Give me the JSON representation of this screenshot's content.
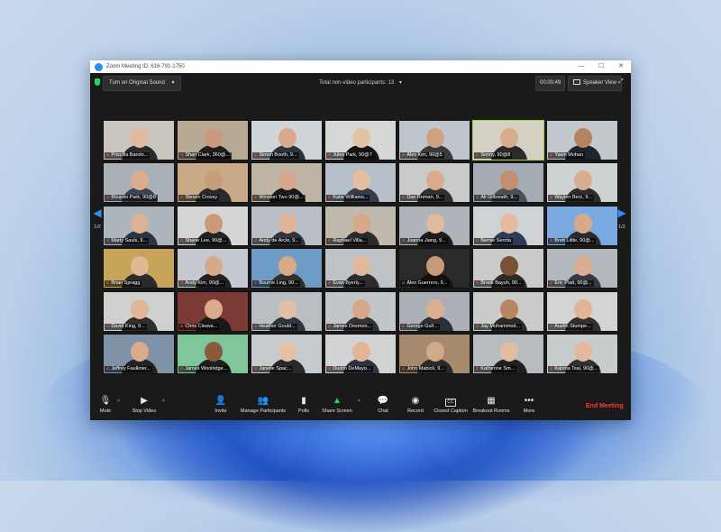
{
  "window": {
    "title": "Zoom Meeting ID: 616-791-1750",
    "controls": {
      "minimize": "—",
      "maximize": "☐",
      "close": "✕"
    }
  },
  "topbar": {
    "original_sound": "Turn on Original Sound",
    "original_sound_caret": "▾",
    "total_participants": "Total non-video participants: 13",
    "total_caret": "▾",
    "timer": "00:00:49",
    "view_button": "Speaker View",
    "fullscreen_glyph": "⤢"
  },
  "colors": {
    "accent": "#2d8cff",
    "end_meeting": "#ff3b30",
    "active_speaker": "#a3d24c",
    "muted": "#ff4d4d"
  },
  "pagination": {
    "left_page": "1/2",
    "right_page": "1/2",
    "left_arrow": "◀",
    "right_arrow": "▶"
  },
  "participants": [
    {
      "name": "Priscilla Barolo...",
      "bg": "#c9c6c0",
      "skin": "#e1b8a0",
      "shirt": "#2b2b2b"
    },
    {
      "name": "Shari Clark, 360@...",
      "bg": "#b7a993",
      "skin": "#c99a7d",
      "shirt": "#1f1f1f"
    },
    {
      "name": "Simon Booth, 9...",
      "bg": "#cfd4d8",
      "skin": "#d9a98c",
      "shirt": "#2c3440"
    },
    {
      "name": "Jules Park, 90@7",
      "bg": "#d6d8d6",
      "skin": "#e4c2a5",
      "shirt": "#151515"
    },
    {
      "name": "Alex Kim, 90@5",
      "bg": "#bfc5cc",
      "skin": "#cfa183",
      "shirt": "#3a3a3a"
    },
    {
      "name": "Sonny, 90@8",
      "bg": "#d4d0c4",
      "skin": "#d7ac8f",
      "shirt": "#2a2a2a",
      "active": true
    },
    {
      "name": "Yasin Mohan",
      "bg": "#c2c8cd",
      "skin": "#b7825f",
      "shirt": "#1d2430"
    },
    {
      "name": "Ricardo Park, 90@8",
      "bg": "#a9b0b6",
      "skin": "#dcae90",
      "shirt": "#3b4350"
    },
    {
      "name": "Steven Crossy",
      "bg": "#c9a986",
      "skin": "#c99c7c",
      "shirt": "#2a2a2a"
    },
    {
      "name": "Winston Twu 90@...",
      "bg": "#bfb5a4",
      "skin": "#d6a98a",
      "shirt": "#1a1a1a"
    },
    {
      "name": "Katie Williams...",
      "bg": "#b7c0c8",
      "skin": "#e6bfa3",
      "shirt": "#363d48"
    },
    {
      "name": "Dan Roman, 9...",
      "bg": "#c8cbc7",
      "skin": "#d9ab8c",
      "shirt": "#2f2f2f"
    },
    {
      "name": "Ali Gilbreath, 9...",
      "bg": "#a4abb2",
      "skin": "#c48f6f",
      "shirt": "#4a4f58"
    },
    {
      "name": "Waylen Berz, 9...",
      "bg": "#cfd2d3",
      "skin": "#d9ad90",
      "shirt": "#2c2c2c"
    },
    {
      "name": "Marty Sauls, 9...",
      "bg": "#adb5bd",
      "skin": "#ddb194",
      "shirt": "#2d3340"
    },
    {
      "name": "Shane Lee, 90@...",
      "bg": "#d3d5d6",
      "skin": "#c99b7b",
      "shirt": "#222"
    },
    {
      "name": "Andy de Arcle, 9...",
      "bg": "#b9bfc5",
      "skin": "#e0b597",
      "shirt": "#303640"
    },
    {
      "name": "Raphael Villa...",
      "bg": "#c0b9ae",
      "skin": "#d7a98a",
      "shirt": "#2b2b2b"
    },
    {
      "name": "Joanna Jiang, 9...",
      "bg": "#aeb4b9",
      "skin": "#e2b99c",
      "shirt": "#1d1d1d"
    },
    {
      "name": "Bernie Serota",
      "bg": "#cfd3d6",
      "skin": "#e4baa0",
      "shirt": "#2f3b52"
    },
    {
      "name": "Brett Little, 90@...",
      "bg": "#7aa9e0",
      "skin": "#d8aa8a",
      "shirt": "#2a2a2a"
    },
    {
      "name": "Brian Spragg",
      "bg": "#c6a55a",
      "skin": "#e0b896",
      "shirt": "#2b2b2b"
    },
    {
      "name": "Andy Kim, 90@...",
      "bg": "#c3c9ce",
      "skin": "#d7a98b",
      "shirt": "#222"
    },
    {
      "name": "Bourne Ling, 90...",
      "bg": "#6f9cc7",
      "skin": "#d8aa8a",
      "shirt": "#2f2f2f"
    },
    {
      "name": "Evan Byerly...",
      "bg": "#bfc3c6",
      "skin": "#e2b89a",
      "shirt": "#2c2c2c"
    },
    {
      "name": "Alex Guerrero, 9...",
      "bg": "#2a2a2a",
      "skin": "#c99a7a",
      "shirt": "#111"
    },
    {
      "name": "Brook Bayuh, 90...",
      "bg": "#c9cbc8",
      "skin": "#7a4f36",
      "shirt": "#2a2a2a"
    },
    {
      "name": "Eric Platt, 90@...",
      "bg": "#b2b8bd",
      "skin": "#dcae90",
      "shirt": "#333a45"
    },
    {
      "name": "David King, 9...",
      "bg": "#cfd1d1",
      "skin": "#e1b596",
      "shirt": "#2e2e2e"
    },
    {
      "name": "Chris Cleave...",
      "bg": "#7b3a33",
      "skin": "#d9ab8c",
      "shirt": "#1a1a1a"
    },
    {
      "name": "Heather Gould...",
      "bg": "#b9bec2",
      "skin": "#e4bea2",
      "shirt": "#2f3640"
    },
    {
      "name": "James Desmon...",
      "bg": "#c2c6c8",
      "skin": "#d6a88a",
      "shirt": "#333"
    },
    {
      "name": "George Gull...",
      "bg": "#aab0b5",
      "skin": "#dcaf90",
      "shirt": "#2b2f38"
    },
    {
      "name": "Jay Mohammed...",
      "bg": "#c9ccc9",
      "skin": "#b9855f",
      "shirt": "#2a2a2a"
    },
    {
      "name": "Austin Stumpe...",
      "bg": "#d3d5d5",
      "skin": "#e0b495",
      "shirt": "#303030"
    },
    {
      "name": "Jeffrey Faulkner...",
      "bg": "#7f93a8",
      "skin": "#d9ab8c",
      "shirt": "#222"
    },
    {
      "name": "James Woolridge...",
      "bg": "#7fc79a",
      "skin": "#8b5a3c",
      "shirt": "#1d1d1d"
    },
    {
      "name": "Janelle Spac...",
      "bg": "#c7cbcd",
      "skin": "#e6c1a5",
      "shirt": "#2a2a2a"
    },
    {
      "name": "Dustin DeMayo...",
      "bg": "#d2d4d4",
      "skin": "#e2b597",
      "shirt": "#2c3440"
    },
    {
      "name": "John Mabick, 9...",
      "bg": "#a58a6e",
      "skin": "#d6a88a",
      "shirt": "#2a2a2a"
    },
    {
      "name": "Katherine Sm...",
      "bg": "#b7bcc0",
      "skin": "#e4bda0",
      "shirt": "#1f1f1f"
    },
    {
      "name": "Katrina Tsai, 90@...",
      "bg": "#c9cccd",
      "skin": "#e2b99c",
      "shirt": "#2f2f2f"
    }
  ],
  "toolbar": {
    "mute": {
      "label": "Mute",
      "icon": "🎙"
    },
    "stop_video": {
      "label": "Stop Video",
      "icon": "▶"
    },
    "caret": "^",
    "invite": {
      "label": "Invite",
      "icon": "👤"
    },
    "manage_participants": {
      "label": "Manage Participants",
      "icon": "👥"
    },
    "polls": {
      "label": "Polls",
      "icon": "▮"
    },
    "share_screen": {
      "label": "Share Screen",
      "icon": "▲"
    },
    "chat": {
      "label": "Chat",
      "icon": "💬"
    },
    "record": {
      "label": "Record",
      "icon": "◉"
    },
    "closed_caption": {
      "label": "Closed Caption",
      "icon": "CC"
    },
    "breakout_rooms": {
      "label": "Breakout Rooms",
      "icon": "▦"
    },
    "more": {
      "label": "More",
      "icon": "•••"
    },
    "end_meeting": "End Meeting"
  }
}
